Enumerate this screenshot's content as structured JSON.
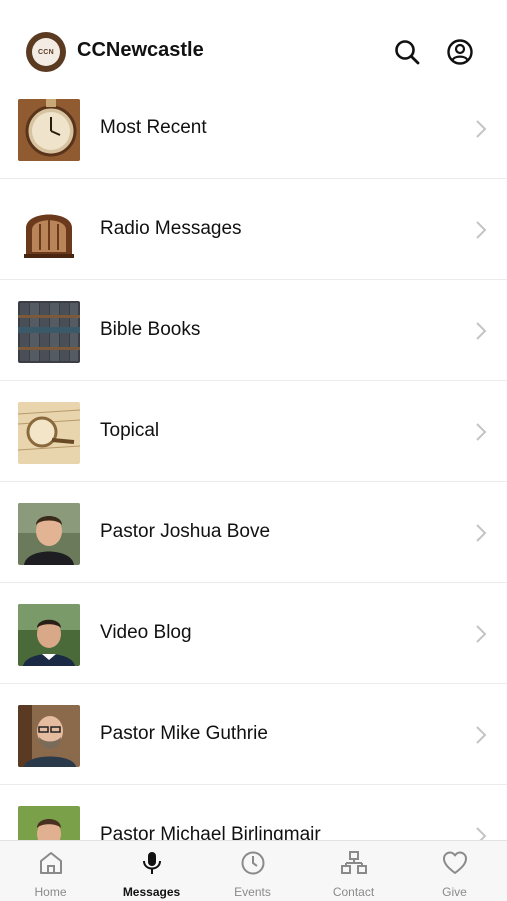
{
  "header": {
    "app_title": "CCNewcastle",
    "logo_text": "CCN",
    "search_icon": "search-icon",
    "account_icon": "account-icon"
  },
  "list": {
    "items": [
      {
        "label": "Most Recent",
        "thumb": "pocket-watch"
      },
      {
        "label": "Radio Messages",
        "thumb": "vintage-radio"
      },
      {
        "label": "Bible Books",
        "thumb": "book-spines"
      },
      {
        "label": "Topical",
        "thumb": "magnifying-glass"
      },
      {
        "label": "Pastor Joshua Bove",
        "thumb": "portrait"
      },
      {
        "label": "Video Blog",
        "thumb": "portrait"
      },
      {
        "label": "Pastor Mike Guthrie",
        "thumb": "portrait"
      },
      {
        "label": "Pastor Michael Birlingmair",
        "thumb": "portrait"
      }
    ]
  },
  "tabbar": {
    "tabs": [
      {
        "label": "Home",
        "icon": "home-icon"
      },
      {
        "label": "Messages",
        "icon": "microphone-icon",
        "active": true
      },
      {
        "label": "Events",
        "icon": "clock-icon"
      },
      {
        "label": "Contact",
        "icon": "org-chart-icon"
      },
      {
        "label": "Give",
        "icon": "heart-icon"
      }
    ]
  },
  "colors": {
    "active_tab": "#111111",
    "inactive_tab": "#8a8a8a",
    "logo_brown": "#5b3a22"
  }
}
